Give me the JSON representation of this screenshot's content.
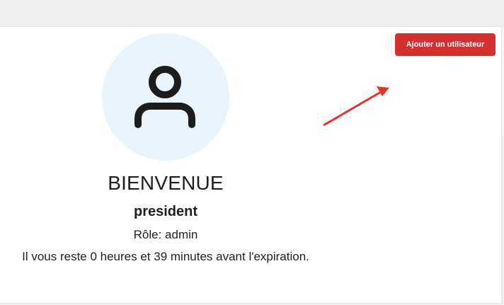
{
  "profile": {
    "greeting": "BIENVENUE",
    "username": "president",
    "role_line": "Rôle: admin",
    "expiry_text": "Il vous reste 0 heures et 39 minutes avant l'expiration.",
    "avatar_icon": "user-icon"
  },
  "actions": {
    "add_user_label": "Ajouter un utilisateur"
  },
  "colors": {
    "button": "#d33030",
    "avatar_bg": "#eaf4fd",
    "annotation_arrow": "#e8322e"
  }
}
